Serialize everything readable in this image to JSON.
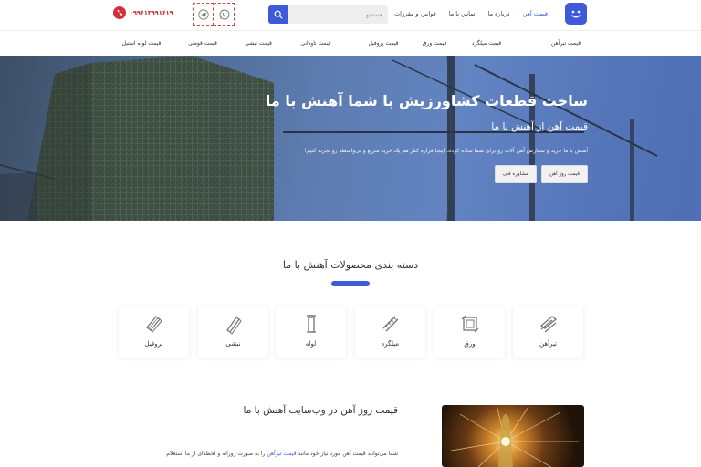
{
  "header": {
    "nav": [
      "قیمت آهن",
      "درباره ما",
      "تماس با ما",
      "قوانین و مقررات"
    ],
    "search": {
      "placeholder": "جستجو"
    },
    "phone": "۰۹۹۶۱۳۹۹۱۶۱۹",
    "colors": {
      "accent": "#3d5bd9",
      "phone": "#d53038"
    },
    "icons": [
      "logo-icon",
      "search-icon",
      "telegram-icon",
      "whatsapp-icon",
      "phone-icon"
    ]
  },
  "categories_menu": [
    "قیمت تیرآهن",
    "قیمت میلگرد",
    "قیمت ورق",
    "قیمت پروفیل",
    "قیمت ناودانی",
    "قیمت نبشی",
    "قیمت قوطی",
    "قیمت لوله استیل"
  ],
  "hero": {
    "title": "ساخت قطعات کشاورزیش با شما آهنش با ما",
    "subtitle": "قیمت آهن از آهنش با ما",
    "description": "آهنش با ما خرید و سفارش آهن آلات رو برای شما ساده کرده. اینجا قراره کنار هم یک خرید سریع و بی‌واسطه رو تجربه کنیم!",
    "buttons": [
      "قیمت روز آهن",
      "مشاوره فنی"
    ]
  },
  "products": {
    "title": "دسته بندی محصولات آهنش با ما",
    "items": [
      {
        "label": "تیرآهن",
        "icon": "ibeam-icon"
      },
      {
        "label": "ورق",
        "icon": "sheet-icon"
      },
      {
        "label": "میلگرد",
        "icon": "rebar-icon"
      },
      {
        "label": "لوله",
        "icon": "pipe-icon"
      },
      {
        "label": "نبشی",
        "icon": "angle-icon"
      },
      {
        "label": "پروفیل",
        "icon": "profile-icon"
      }
    ]
  },
  "price_section": {
    "title": "قیمت روز آهن در وب‌سایت آهنش با ما",
    "text_before": "شما می‌توانید قیمت آهن مورد نیاز خود مانند ",
    "link": "قیمت تیرآهن",
    "text_after": " را به صورت روزانه و لحظه‌ای از ما استعلام"
  }
}
